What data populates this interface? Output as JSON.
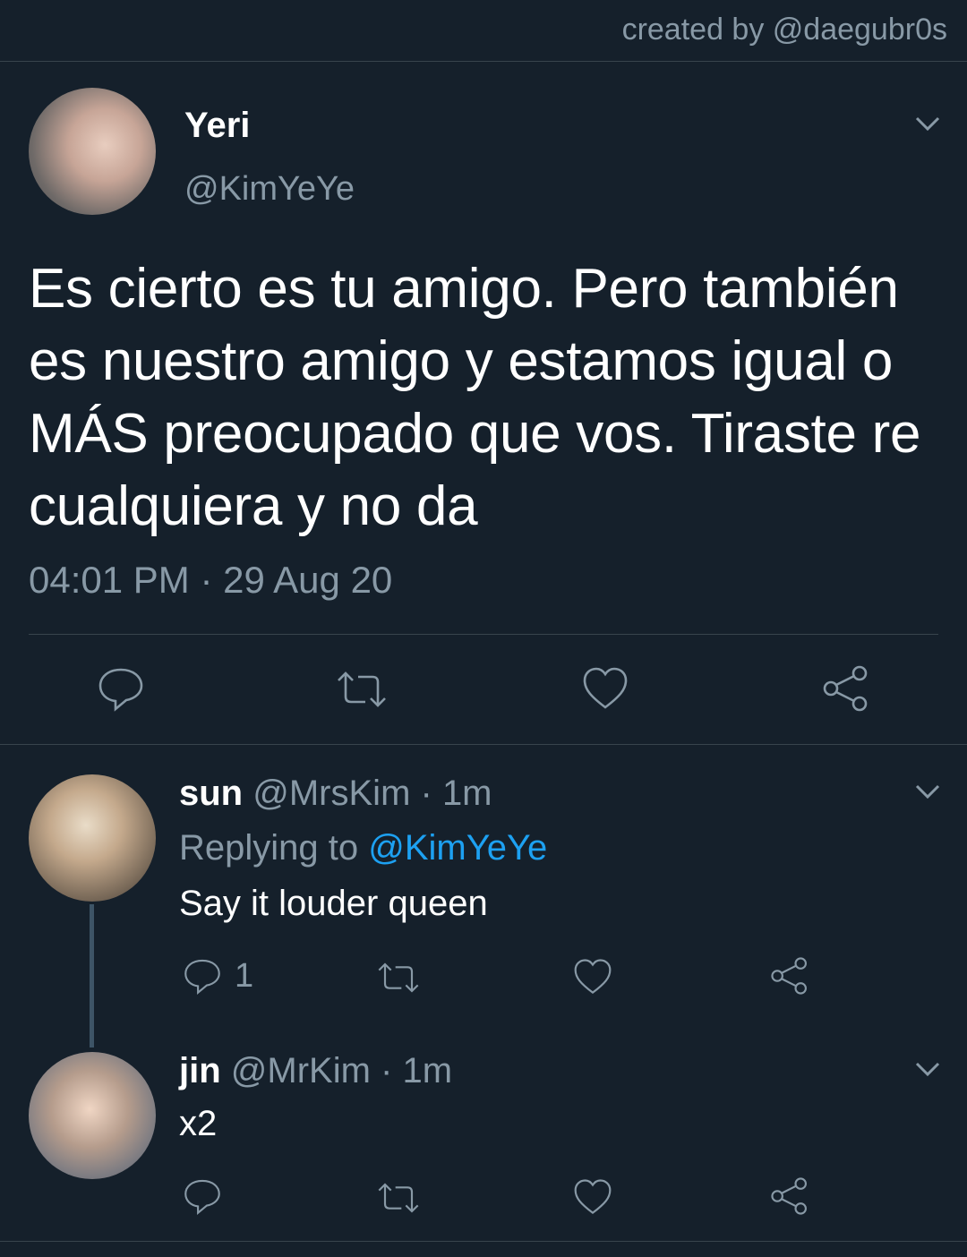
{
  "credit": "created by @daegubr0s",
  "main_tweet": {
    "name": "Yeri",
    "handle": "@KimYeYe",
    "text": "Es cierto es tu amigo. Pero también es nuestro amigo y estamos igual o MÁS preocupado que vos. Tiraste re cualquiera y no da",
    "timestamp": "04:01 PM · 29 Aug 20"
  },
  "replies": [
    {
      "name": "sun",
      "handle": "@MrsKim",
      "time": " · 1m",
      "replying_label": "Replying to ",
      "replying_handle": "@KimYeYe",
      "text": "Say it louder queen",
      "reply_count": "1"
    },
    {
      "name": "jin",
      "handle": "@MrKim",
      "time": " · 1m",
      "text": "x2"
    }
  ],
  "icons": {
    "reply": "reply-icon",
    "retweet": "retweet-icon",
    "like": "heart-icon",
    "share": "share-icon",
    "more": "chevron-down-icon"
  },
  "colors": {
    "background": "#15202b",
    "muted": "#8899a6",
    "link": "#1da1f2",
    "divider": "#38444d"
  }
}
